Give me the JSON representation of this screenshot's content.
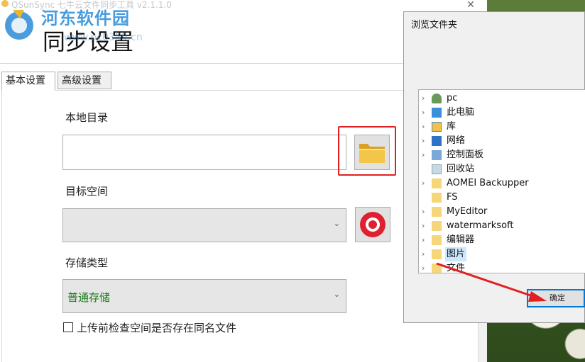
{
  "window": {
    "title": "QSunSync 七牛云文件同步工具 v2.1.1.0"
  },
  "watermark": {
    "site_name": "河东软件园",
    "url": "www.pc0359.cn"
  },
  "header": {
    "title": "同步设置"
  },
  "tabs": [
    {
      "label": "基本设置",
      "active": true
    },
    {
      "label": "高级设置",
      "active": false
    }
  ],
  "form": {
    "local_dir_label": "本地目录",
    "local_dir_value": "",
    "target_space_label": "目标空间",
    "target_space_value": "",
    "storage_type_label": "存储类型",
    "storage_type_value": "普通存储",
    "check_label": "上传前检查空间是否存在同名文件",
    "check_checked": false
  },
  "dialog": {
    "title": "浏览文件夹",
    "close_glyph": "✕",
    "ok_label": "确定",
    "items": [
      {
        "label": "pc",
        "icon": "user-icon",
        "expandable": true
      },
      {
        "label": "此电脑",
        "icon": "computer-icon",
        "expandable": true
      },
      {
        "label": "库",
        "icon": "library-icon",
        "expandable": true
      },
      {
        "label": "网络",
        "icon": "network-icon",
        "expandable": true
      },
      {
        "label": "控制面板",
        "icon": "control-panel-icon",
        "expandable": true
      },
      {
        "label": "回收站",
        "icon": "recycle-bin-icon",
        "expandable": false
      },
      {
        "label": "AOMEI Backupper",
        "icon": "folder-icon",
        "expandable": true
      },
      {
        "label": "FS",
        "icon": "folder-icon",
        "expandable": false
      },
      {
        "label": "MyEditor",
        "icon": "folder-icon",
        "expandable": true
      },
      {
        "label": "watermarksoft",
        "icon": "folder-icon",
        "expandable": true
      },
      {
        "label": "编辑器",
        "icon": "folder-icon",
        "expandable": true
      },
      {
        "label": "图片",
        "icon": "folder-icon",
        "expandable": true,
        "selected": true
      },
      {
        "label": "文件",
        "icon": "folder-icon",
        "expandable": true
      }
    ]
  },
  "colors": {
    "highlight_red": "#e02020",
    "storage_text_green": "#1a7a1a",
    "accent_blue": "#0078d7"
  }
}
